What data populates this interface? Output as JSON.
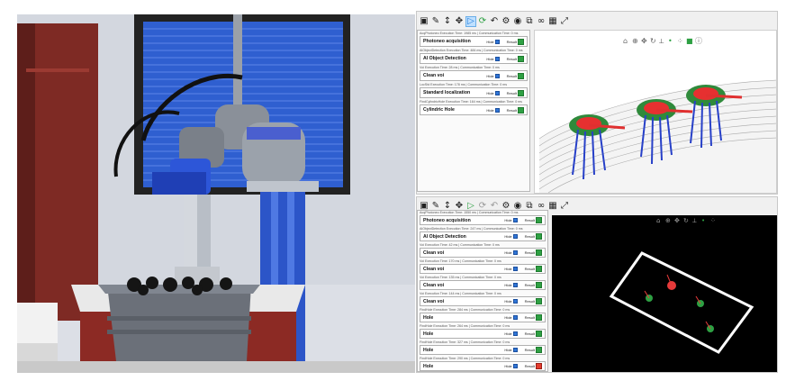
{
  "top_panel": {
    "toolbar_icons": [
      "save-icon",
      "edit-icon",
      "move-vertical-icon",
      "move-icon",
      "play-icon",
      "run-step-icon",
      "undo-icon",
      "settings-icon",
      "eye-icon",
      "network-icon",
      "link-icon",
      "grid-icon",
      "fullscreen-icon"
    ],
    "steps": [
      {
        "caption": "AcqPhotoneo Execution Time: 1985 ms | Communication Time: 0 ms",
        "name": "Photoneo acquisition",
        "hide_label": "Hide",
        "result_label": "Result",
        "result": "ok"
      },
      {
        "caption": "AiObjectDetection Execution Time: 484 ms | Communication Time: 0 ms",
        "name": "AI Object Detection",
        "hide_label": "Hide",
        "result_label": "Result",
        "result": "ok"
      },
      {
        "caption": "Voi Execution Time: 28 ms | Communication Time: 0 ms",
        "name": "Clean voi",
        "hide_label": "Hide",
        "result_label": "Result",
        "result": "ok"
      },
      {
        "caption": "LocStd Execution Time: 178 ms | Communication Time: 0 ms",
        "name": "Standard localization",
        "hide_label": "Hide",
        "result_label": "Result",
        "result": "ok"
      },
      {
        "caption": "FindCylindricHole Execution Time: 164 ms | Communication Time: 0 ms",
        "name": "Cylindric Hole",
        "hide_label": "Hide",
        "result_label": "Result",
        "result": "ok"
      }
    ]
  },
  "bottom_panel": {
    "steps": [
      {
        "caption": "AcqPhotoneo Execution Time: 1550 ms | Communication Time: 0 ms",
        "name": "Photoneo acquisition",
        "hide_label": "Hide",
        "result_label": "Result",
        "result": "ok"
      },
      {
        "caption": "AiObjectDetection Execution Time: 247 ms | Communication Time: 0 ms",
        "name": "AI Object Detection",
        "hide_label": "Hide",
        "result_label": "Result",
        "result": "ok"
      },
      {
        "caption": "Voi Execution Time: 42 ms | Communication Time: 0 ms",
        "name": "Clean voi",
        "hide_label": "Hide",
        "result_label": "Result",
        "result": "ok"
      },
      {
        "caption": "Voi Execution Time: 170 ms | Communication Time: 0 ms",
        "name": "Clean voi",
        "hide_label": "Hide",
        "result_label": "Result",
        "result": "ok"
      },
      {
        "caption": "Voi Execution Time: 135 ms | Communication Time: 0 ms",
        "name": "Clean voi",
        "hide_label": "Hide",
        "result_label": "Result",
        "result": "ok"
      },
      {
        "caption": "Voi Execution Time: 144 ms | Communication Time: 0 ms",
        "name": "Clean voi",
        "hide_label": "Hide",
        "result_label": "Result",
        "result": "ok"
      },
      {
        "caption": "FindHole Execution Time: 284 ms | Communication Time: 0 ms",
        "name": "Hole",
        "hide_label": "Hide",
        "result_label": "Result",
        "result": "ok"
      },
      {
        "caption": "FindHole Execution Time: 264 ms | Communication Time: 0 ms",
        "name": "Hole",
        "hide_label": "Hide",
        "result_label": "Result",
        "result": "ok"
      },
      {
        "caption": "FindHole Execution Time: 327 ms | Communication Time: 0 ms",
        "name": "Hole",
        "hide_label": "Hide",
        "result_label": "Result",
        "result": "ok"
      },
      {
        "caption": "FindHole Execution Time: 290 ms | Communication Time: 0 ms",
        "name": "Hole",
        "hide_label": "Hide",
        "result_label": "Result",
        "result": "fail"
      }
    ]
  },
  "colors": {
    "ok": "#2ea043",
    "fail": "#e23b2e",
    "hide_checkbox": "#2f75d6",
    "pick_frame": "#ffffff",
    "axis_x": "#e03030",
    "axis_y": "#2fa84a",
    "axis_z": "#2740c8"
  }
}
